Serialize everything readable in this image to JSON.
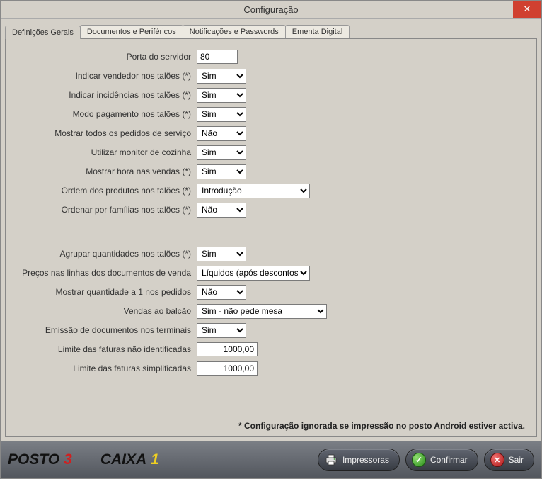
{
  "window": {
    "title": "Configuração"
  },
  "tabs": [
    "Definições Gerais",
    "Documentos e Periféricos",
    "Notificações e Passwords",
    "Ementa Digital"
  ],
  "form": {
    "porta_servidor": {
      "label": "Porta do servidor",
      "value": "80"
    },
    "indicar_vendedor": {
      "label": "Indicar vendedor nos talões (*)",
      "value": "Sim"
    },
    "indicar_incidencias": {
      "label": "Indicar incidências nos talões (*)",
      "value": "Sim"
    },
    "modo_pagamento": {
      "label": "Modo pagamento nos talões (*)",
      "value": "Sim"
    },
    "mostrar_pedidos_servico": {
      "label": "Mostrar todos os pedidos de serviço",
      "value": "Não"
    },
    "monitor_cozinha": {
      "label": "Utilizar monitor de cozinha",
      "value": "Sim"
    },
    "mostrar_hora_vendas": {
      "label": "Mostrar hora nas vendas (*)",
      "value": "Sim"
    },
    "ordem_produtos": {
      "label": "Ordem dos produtos nos talões (*)",
      "value": "Introdução"
    },
    "ordenar_familias": {
      "label": "Ordenar por famílias nos talões (*)",
      "value": "Não"
    },
    "agrupar_quantidades": {
      "label": "Agrupar quantidades nos talões (*)",
      "value": "Sim"
    },
    "precos_linhas": {
      "label": "Preços nas linhas dos documentos de venda",
      "value": "Líquidos (após descontos)"
    },
    "mostrar_qtd_1": {
      "label": "Mostrar quantidade a 1 nos pedidos",
      "value": "Não"
    },
    "vendas_balcao": {
      "label": "Vendas ao balcão",
      "value": "Sim - não pede mesa"
    },
    "emissao_docs_terminais": {
      "label": "Emissão de documentos nos terminais",
      "value": "Sim"
    },
    "limite_faturas_nao_id": {
      "label": "Limite das faturas não identificadas",
      "value": "1000,00"
    },
    "limite_faturas_simpl": {
      "label": "Limite das faturas simplificadas",
      "value": "1000,00"
    }
  },
  "footnote": "* Configuração ignorada se impressão no posto Android estiver activa.",
  "footer": {
    "posto_label": "POSTO",
    "posto_num": "3",
    "caixa_label": "CAIXA",
    "caixa_num": "1",
    "btn_impressoras": "Impressoras",
    "btn_confirmar": "Confirmar",
    "btn_sair": "Sair"
  }
}
